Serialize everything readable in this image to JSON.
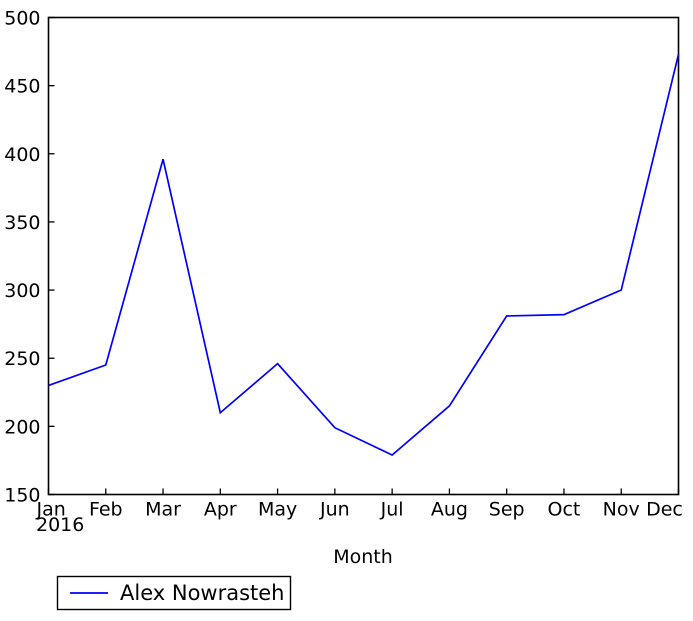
{
  "chart_data": {
    "type": "line",
    "title": "",
    "xlabel": "Month",
    "ylabel": "",
    "categories": [
      "Jan",
      "Feb",
      "Mar",
      "Apr",
      "May",
      "Jun",
      "Jul",
      "Aug",
      "Sep",
      "Oct",
      "Nov",
      "Dec"
    ],
    "x_sublabel": "2016",
    "xtick_labels": [
      "Jan",
      "Feb",
      "Mar",
      "Apr",
      "May",
      "Jun",
      "Jul",
      "Aug",
      "Sep",
      "Oct",
      "Nov",
      "Dec"
    ],
    "ytick_labels": [
      "150",
      "200",
      "250",
      "300",
      "350",
      "400",
      "450",
      "500"
    ],
    "ytick_values": [
      150,
      200,
      250,
      300,
      350,
      400,
      450,
      500
    ],
    "ylim": [
      150,
      500
    ],
    "grid": false,
    "legend_position": "below-left",
    "series": [
      {
        "name": "Alex Nowrasteh",
        "color": "#0000ff",
        "values": [
          230,
          245,
          396,
          210,
          246,
          199,
          179,
          215,
          281,
          282,
          300,
          473
        ]
      }
    ]
  },
  "legend": {
    "entries": [
      {
        "label": "Alex Nowrasteh",
        "color": "#0000ff"
      }
    ]
  },
  "axes": {
    "x_axis_label": "Month",
    "x_year_label": "2016"
  }
}
